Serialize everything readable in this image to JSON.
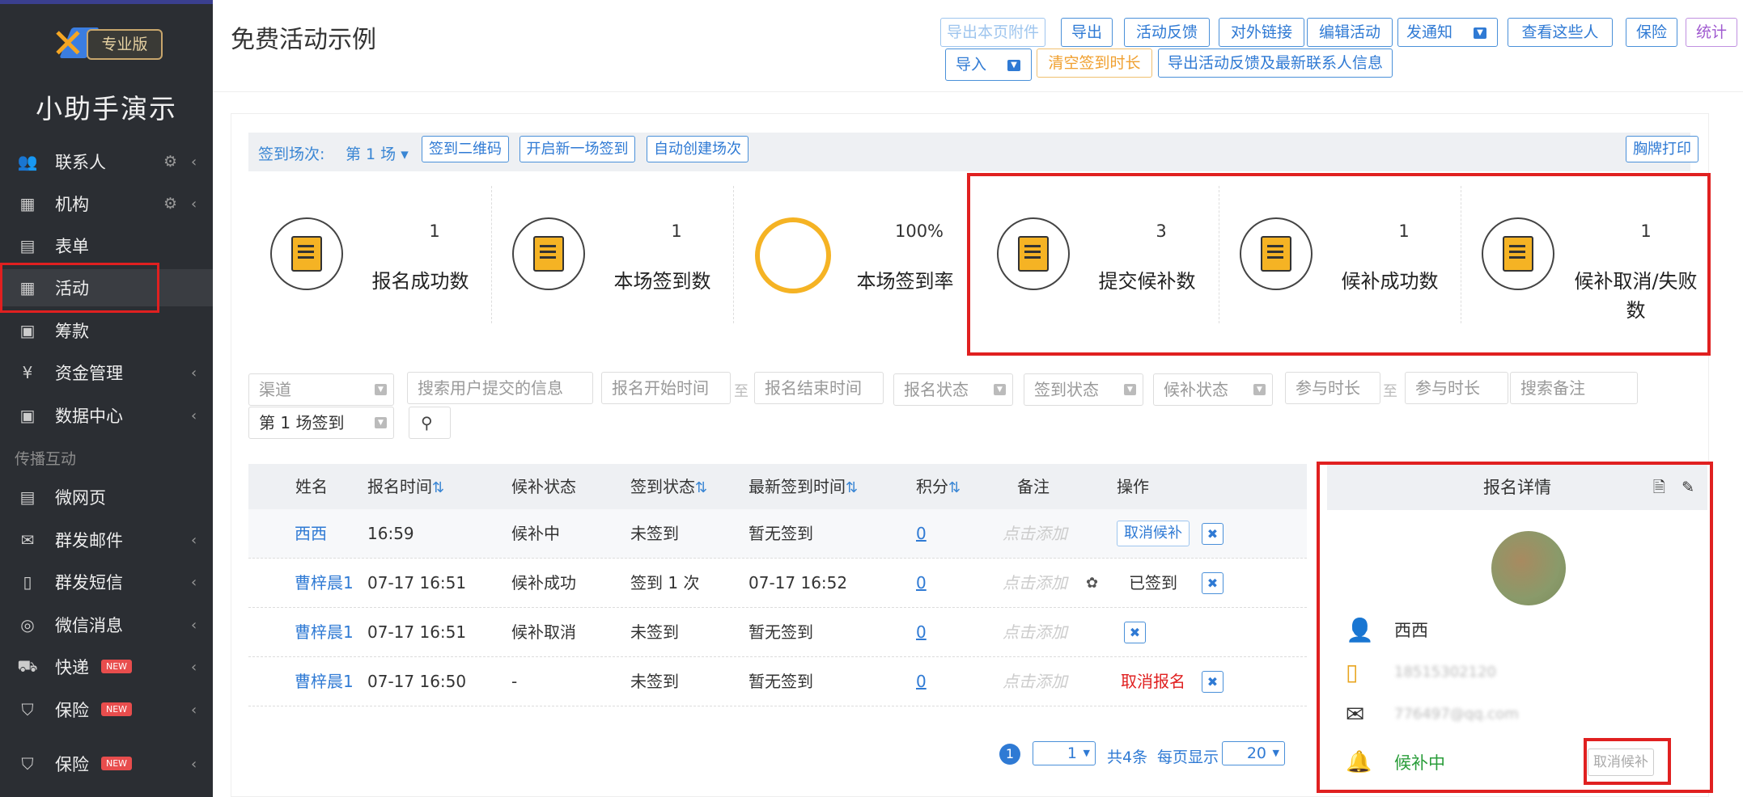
{
  "sidebar": {
    "logo_badge": "专业版",
    "org_name": "小助手演示",
    "items": [
      {
        "label": "联系人",
        "icon": "contacts-icon"
      },
      {
        "label": "机构",
        "icon": "building-icon"
      },
      {
        "label": "表单",
        "icon": "form-icon"
      },
      {
        "label": "活动",
        "icon": "calendar-icon"
      },
      {
        "label": "筹款",
        "icon": "fundraise-icon"
      },
      {
        "label": "资金管理",
        "icon": "yen-icon"
      },
      {
        "label": "数据中心",
        "icon": "data-icon"
      },
      {
        "label": "微网页",
        "icon": "page-icon"
      },
      {
        "label": "群发邮件",
        "icon": "mail-icon"
      },
      {
        "label": "群发短信",
        "icon": "phone-icon"
      },
      {
        "label": "微信消息",
        "icon": "wechat-icon"
      },
      {
        "label": "快递",
        "icon": "truck-icon",
        "badge": "NEW"
      },
      {
        "label": "保险",
        "icon": "shield-icon",
        "badge": "NEW"
      },
      {
        "label": "保险",
        "icon": "shield-icon",
        "badge": "NEW"
      }
    ],
    "section_label": "传播互动"
  },
  "header": {
    "title": "免费活动示例",
    "buttons": [
      "导出本页附件",
      "导出",
      "活动反馈",
      "对外链接",
      "编辑活动",
      "发通知",
      "查看这些人",
      "保险",
      "统计"
    ],
    "buttons2": [
      "导入",
      "清空签到时长",
      "导出活动反馈及最新联系人信息"
    ]
  },
  "signin": {
    "label": "签到场次:",
    "session": "第 1 场 ▾",
    "qr_btn": "签到二维码",
    "new_btn": "开启新一场签到",
    "auto_btn": "自动创建场次",
    "print_btn": "胸牌打印"
  },
  "stats": [
    {
      "num": "1",
      "name": "报名成功数"
    },
    {
      "num": "1",
      "name": "本场签到数"
    },
    {
      "num": "100%",
      "name": "本场签到率"
    },
    {
      "num": "3",
      "name": "提交候补数"
    },
    {
      "num": "1",
      "name": "候补成功数"
    },
    {
      "num": "1",
      "name": "候补取消/失败数"
    }
  ],
  "filters": {
    "channel": "渠道",
    "search_info": "搜索用户提交的信息",
    "reg_start": "报名开始时间",
    "to": "至",
    "reg_end": "报名结束时间",
    "reg_status": "报名状态",
    "sign_status": "签到状态",
    "wait_status": "候补状态",
    "dur1": "参与时长",
    "dur2": "参与时长",
    "search_note": "搜索备注",
    "session_sel": "第 1 场签到"
  },
  "table": {
    "headers": [
      "姓名",
      "报名时间",
      "候补状态",
      "签到状态",
      "最新签到时间",
      "积分",
      "备注",
      "操作"
    ],
    "rows": [
      {
        "name": "西西",
        "time": "16:59",
        "wait": "候补中",
        "sign": "未签到",
        "last": "暂无签到",
        "points": "0",
        "remark": "点击添加",
        "op": "取消候补"
      },
      {
        "name": "曹梓晨1",
        "time": "07-17 16:51",
        "wait": "候补成功",
        "sign": "签到 1 次",
        "last": "07-17 16:52",
        "points": "0",
        "remark": "点击添加",
        "op": "已签到"
      },
      {
        "name": "曹梓晨1",
        "time": "07-17 16:51",
        "wait": "候补取消",
        "sign": "未签到",
        "last": "暂无签到",
        "points": "0",
        "remark": "点击添加",
        "op": ""
      },
      {
        "name": "曹梓晨1",
        "time": "07-17 16:50",
        "wait": "-",
        "sign": "未签到",
        "last": "暂无签到",
        "points": "0",
        "remark": "点击添加",
        "op": "取消报名"
      }
    ]
  },
  "pager": {
    "current": "1",
    "page_sel": "1",
    "total": "共4条",
    "per_label": "每页显示",
    "per": "20"
  },
  "detail": {
    "title": "报名详情",
    "name": "西西",
    "phone": "18515302120",
    "email": "776497@qq.com",
    "status": "候补中",
    "cancel_btn": "取消候补"
  }
}
